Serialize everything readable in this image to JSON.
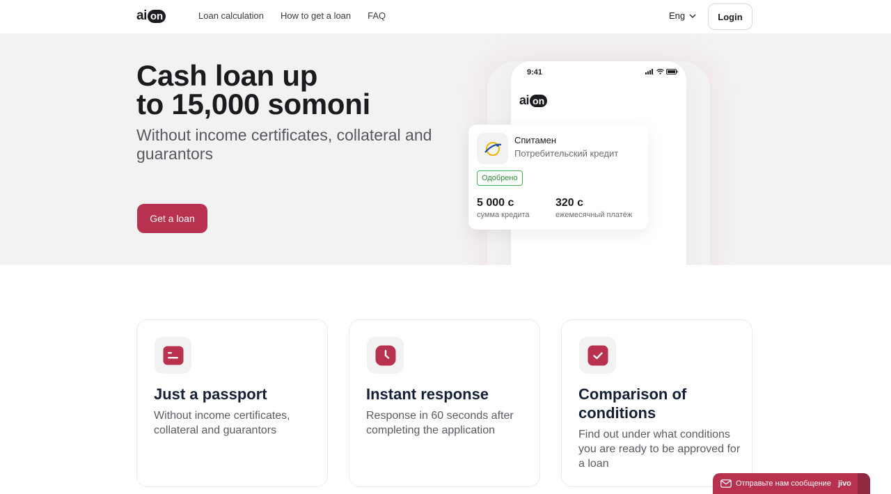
{
  "header": {
    "logo_ai": "ai",
    "logo_on": "on",
    "nav": [
      {
        "label": "Loan calculation"
      },
      {
        "label": "How to get a loan"
      },
      {
        "label": "FAQ"
      }
    ],
    "lang": "Eng",
    "login": "Login"
  },
  "hero": {
    "title_line1": "Cash loan up",
    "title_line2": "to 15,000 somoni",
    "subtitle": "Without income certificates, collateral and guarantors",
    "cta": "Get a loan",
    "accent_color": "#b8324f",
    "phone": {
      "time": "9:41",
      "logo_ai": "ai",
      "logo_on": "on"
    },
    "loan_card": {
      "bank_name": "Спитамен",
      "product": "Потребительский кредит",
      "status": "Одобрено",
      "amount": "5 000 с",
      "amount_label": "сумма кредита",
      "payment": "320 с",
      "payment_label": "ежемесячный платёж"
    }
  },
  "features": [
    {
      "title": "Just a passport",
      "desc": "Without income certificates, collateral and guarantors",
      "icon": "passport-icon"
    },
    {
      "title": "Instant response",
      "desc": "Response in 60 seconds after completing the application",
      "icon": "clock-icon"
    },
    {
      "title": "Comparison of conditions",
      "desc": "Find out under what conditions you are ready to be approved for a loan",
      "icon": "check-icon"
    }
  ],
  "chat": {
    "label": "Отправьте нам сообщение",
    "brand": "jivo"
  }
}
